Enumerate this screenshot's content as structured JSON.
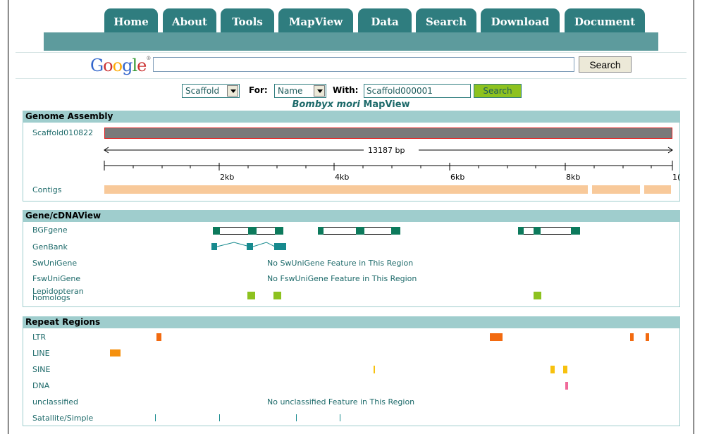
{
  "nav": {
    "tabs": [
      "Home",
      "About",
      "Tools",
      "MapView",
      "Data",
      "Search",
      "Download",
      "Document"
    ]
  },
  "google": {
    "logo_letters": [
      "G",
      "o",
      "o",
      "g",
      "l",
      "e"
    ],
    "logo_tm": "®",
    "search_value": "",
    "search_button": "Search"
  },
  "controls": {
    "type_select": "Scaffold",
    "for_label": "For:",
    "for_select": "Name",
    "with_label": "With:",
    "with_value": "Scaffold000001",
    "search_button": "Search"
  },
  "title": {
    "italic": "Bombyx mori",
    "rest": " MapView"
  },
  "genome_assembly": {
    "header": "Genome Assembly",
    "scaffold_label": "Scaffold010822",
    "length_label": "13187 bp",
    "ticks": [
      "2kb",
      "4kb",
      "6kb",
      "8kb",
      "1("
    ],
    "contigs_label": "Contigs"
  },
  "gene_view": {
    "header": "Gene/cDNAView",
    "rows": [
      "BGFgene",
      "GenBank",
      "SwUniGene",
      "FswUniGene",
      "Lepidopteran homologs"
    ],
    "no_sw": "No SwUniGene  Feature in This Region",
    "no_fsw": "No FswUniGene  Feature in This Region"
  },
  "repeats": {
    "header": "Repeat Regions",
    "rows": [
      "LTR",
      "LINE",
      "SINE",
      "DNA",
      "unclassified",
      "Satallite/Simple"
    ],
    "no_unclassified": "No unclassified  Feature in This Region"
  },
  "colors": {
    "tab": "#2f7d7f",
    "section_header": "#9fcdcd",
    "gene": "#0d7a5c",
    "genbank": "#178a8e",
    "homolog": "#8dc21f",
    "contig": "#f8c99a",
    "ltr": "#f26a10",
    "line": "#f5900e",
    "sine": "#f7c10e",
    "dna": "#f06a9a"
  }
}
